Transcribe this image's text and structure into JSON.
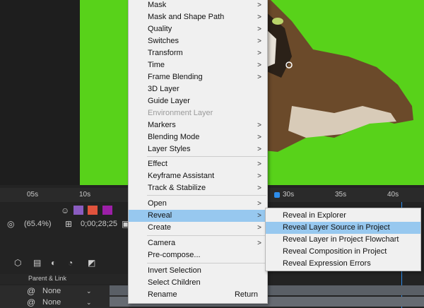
{
  "timeline": {
    "ruler_labels": [
      "05s",
      "10s",
      "30s",
      "35s",
      "40s"
    ],
    "zoom": "(65.4%)",
    "timecode": "0;00;28;25",
    "parent_link_header": "Parent & Link",
    "parent_values": [
      "None",
      "None"
    ]
  },
  "context_menu": {
    "items": [
      {
        "label": "Mask",
        "submenu": true
      },
      {
        "label": "Mask and Shape Path",
        "submenu": true
      },
      {
        "label": "Quality",
        "submenu": true
      },
      {
        "label": "Switches",
        "submenu": true
      },
      {
        "label": "Transform",
        "submenu": true
      },
      {
        "label": "Time",
        "submenu": true
      },
      {
        "label": "Frame Blending",
        "submenu": true
      },
      {
        "label": "3D Layer"
      },
      {
        "label": "Guide Layer"
      },
      {
        "label": "Environment Layer",
        "disabled": true
      },
      {
        "label": "Markers",
        "submenu": true
      },
      {
        "label": "Blending Mode",
        "submenu": true
      },
      {
        "label": "Layer Styles",
        "submenu": true
      },
      {
        "label": "Effect",
        "submenu": true
      },
      {
        "label": "Keyframe Assistant",
        "submenu": true
      },
      {
        "label": "Track & Stabilize",
        "submenu": true
      },
      {
        "label": "Open",
        "submenu": true
      },
      {
        "label": "Reveal",
        "submenu": true,
        "highlighted": true
      },
      {
        "label": "Create",
        "submenu": true
      },
      {
        "label": "Camera",
        "submenu": true
      },
      {
        "label": "Pre-compose..."
      },
      {
        "label": "Invert Selection"
      },
      {
        "label": "Select Children"
      },
      {
        "label": "Rename",
        "shortcut": "Return"
      }
    ]
  },
  "reveal_submenu": {
    "items": [
      {
        "label": "Reveal in Explorer"
      },
      {
        "label": "Reveal Layer Source in Project",
        "highlighted": true
      },
      {
        "label": "Reveal Layer in Project Flowchart"
      },
      {
        "label": "Reveal Composition in Project"
      },
      {
        "label": "Reveal Expression Errors"
      }
    ]
  },
  "colors": {
    "green_screen": "#58d21a",
    "highlight": "#97c8ef",
    "menu_bg": "#f0f0f0",
    "playhead": "#2d8ceb"
  }
}
